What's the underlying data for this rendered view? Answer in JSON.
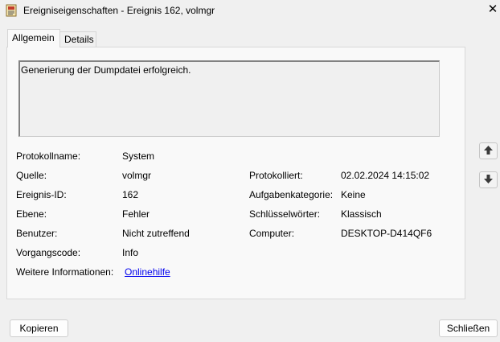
{
  "window": {
    "title": "Ereigniseigenschaften - Ereignis 162, volmgr",
    "close_symbol": "✕"
  },
  "tabs": [
    {
      "label": "Allgemein",
      "active": true
    },
    {
      "label": "Details",
      "active": false
    }
  ],
  "description": "Generierung der Dumpdatei erfolgreich.",
  "fields": {
    "protokollname": {
      "label": "Protokollname:",
      "value": "System"
    },
    "quelle": {
      "label": "Quelle:",
      "value": "volmgr"
    },
    "protokolliert": {
      "label": "Protokolliert:",
      "value": "02.02.2024 14:15:02"
    },
    "ereignis_id": {
      "label": "Ereignis-ID:",
      "value": "162"
    },
    "aufgabenkategorie": {
      "label": "Aufgabenkategorie:",
      "value": "Keine"
    },
    "ebene": {
      "label": "Ebene:",
      "value": "Fehler"
    },
    "schluesselwoerter": {
      "label": "Schlüsselwörter:",
      "value": "Klassisch"
    },
    "benutzer": {
      "label": "Benutzer:",
      "value": "Nicht zutreffend"
    },
    "computer": {
      "label": "Computer:",
      "value": "DESKTOP-D414QF6"
    },
    "vorgangscode": {
      "label": "Vorgangscode:",
      "value": "Info"
    },
    "weitere_info": {
      "label": "Weitere Informationen:",
      "value": "Onlinehilfe"
    }
  },
  "buttons": {
    "copy": "Kopieren",
    "close": "Schließen"
  },
  "icons": {
    "app": "event-properties-icon",
    "up": "arrow-up-icon",
    "down": "arrow-down-icon"
  },
  "colors": {
    "link": "#0000ee",
    "arrow": "#3a3a3a"
  }
}
